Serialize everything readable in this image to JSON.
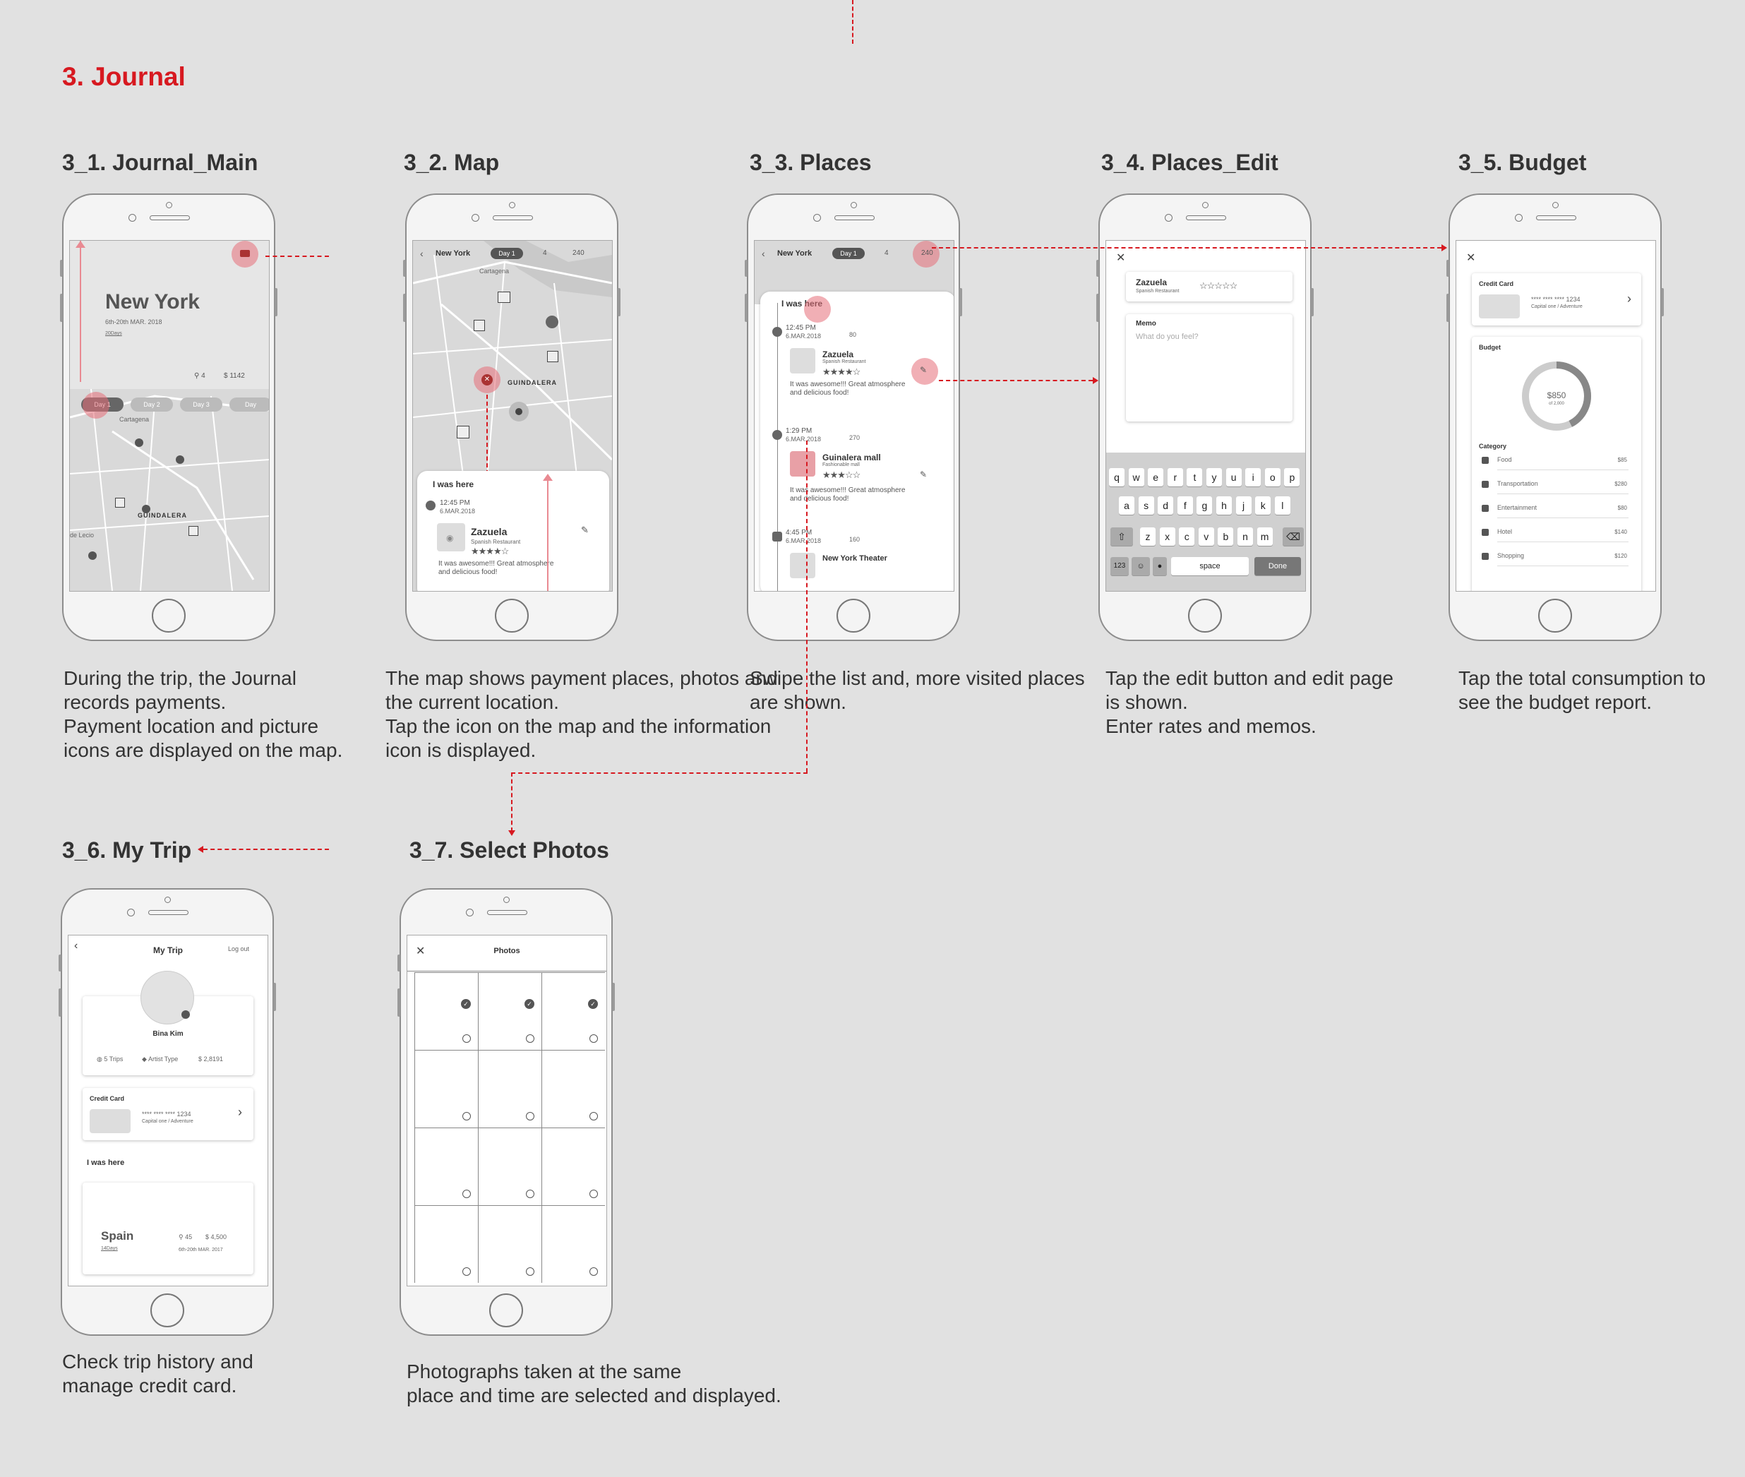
{
  "section": {
    "title": "3. Journal"
  },
  "screens": [
    {
      "title": "3_1. Journal_Main",
      "desc": "During the trip, the Journal\nrecords payments.\nPayment location and picture\nicons are displayed on the map."
    },
    {
      "title": "3_2. Map",
      "desc": "The map shows payment places, photos and\nthe current location.\nTap the icon on the map and  the information\nicon is displayed."
    },
    {
      "title": "3_3. Places",
      "desc": "Swipe the list and, more  visited places\nare shown."
    },
    {
      "title": "3_4. Places_Edit",
      "desc": "Tap the edit button and edit page\nis shown.\nEnter rates and memos."
    },
    {
      "title": "3_5. Budget",
      "desc": "Tap the total consumption to\nsee the budget report."
    },
    {
      "title": "3_6. My Trip",
      "desc": "Check trip history and\nmanage credit card."
    },
    {
      "title": "3_7. Select Photos",
      "desc": "Photographs taken at the same\nplace and time are selected and displayed."
    }
  ],
  "journal_main": {
    "city": "New York",
    "dates": "6th-20th MAR. 2018",
    "duration": "20Days",
    "pins": "4",
    "spent": "1142",
    "days": [
      "Day 1",
      "Day 2",
      "Day 3",
      "Day"
    ],
    "map_labels": [
      "Cartagena",
      "GUINDALERA",
      "de Lecio"
    ]
  },
  "map": {
    "city": "New York",
    "day": "Day 1",
    "pins": "4",
    "spent": "240",
    "area": "GUINDALERA",
    "street": "Cartagena",
    "i_was_here": "I was here",
    "time": "12:45 PM",
    "date": "6.MAR.2018",
    "place": "Zazuela",
    "type": "Spanish Restaurant",
    "stars": "★★★★☆",
    "comment": "It was awesome!!! Great atmosphere\nand delicious food!"
  },
  "places": {
    "city": "New York",
    "day": "Day 1",
    "pins": "4",
    "spent": "240",
    "i_was_here": "I was here",
    "items": [
      {
        "time": "12:45 PM",
        "date": "6.MAR.2018",
        "amount": "80",
        "name": "Zazuela",
        "type": "Spanish Restaurant",
        "stars": "★★★★☆",
        "comment": "It was awesome!!! Great atmosphere\nand delicious food!"
      },
      {
        "time": "1:29 PM",
        "date": "6.MAR.2018",
        "amount": "270",
        "name": "Guinalera mall",
        "type": "Fashionable mall",
        "stars": "★★★☆☆",
        "comment": "It was awesome!!! Great atmosphere\nand delicious food!"
      },
      {
        "time": "4:45 PM",
        "date": "6.MAR.2018",
        "amount": "160",
        "name": "New York Theater",
        "type": "",
        "stars": "",
        "comment": ""
      }
    ]
  },
  "places_edit": {
    "place": "Zazuela",
    "type": "Spanish Restaurant",
    "stars": "☆☆☆☆☆",
    "memo_label": "Memo",
    "memo_placeholder": "What do you feel?",
    "row1": [
      "q",
      "w",
      "e",
      "r",
      "t",
      "y",
      "u",
      "i",
      "o",
      "p"
    ],
    "row2": [
      "a",
      "s",
      "d",
      "f",
      "g",
      "h",
      "j",
      "k",
      "l"
    ],
    "row3": [
      "z",
      "x",
      "c",
      "v",
      "b",
      "n",
      "m"
    ],
    "key_123": "123",
    "key_space": "space",
    "key_done": "Done"
  },
  "budget": {
    "card_label": "Credit Card",
    "card_number": "**** **** **** 1234",
    "card_name": "Capital one / Adventure",
    "budget_label": "Budget",
    "total": "$850",
    "of_total": "of 2,000",
    "category_label": "Category",
    "progress": 0.425,
    "categories": [
      {
        "name": "Food",
        "amount": "$85"
      },
      {
        "name": "Transportation",
        "amount": "$280"
      },
      {
        "name": "Entertainment",
        "amount": "$80"
      },
      {
        "name": "Hotel",
        "amount": "$140"
      },
      {
        "name": "Shopping",
        "amount": "$120"
      }
    ]
  },
  "my_trip": {
    "title": "My Trip",
    "logout": "Log out",
    "user": "Bina Kim",
    "trips": "5 Trips",
    "type": "Artist Type",
    "total": "2,8191",
    "card_label": "Credit Card",
    "card_number": "**** **** **** 1234",
    "card_name": "Capital one / Adventure",
    "i_was_here": "I was here",
    "trip_country": "Spain",
    "trip_duration": "14Days",
    "trip_pins": "45",
    "trip_spent": "4,500",
    "trip_dates": "6th-20th MAR. 2017"
  },
  "photos": {
    "title": "Photos",
    "grid_rows": 4,
    "grid_cols": 3,
    "checked_row": 0
  },
  "colors": {
    "accent": "#d71920",
    "pin": "#e66e78",
    "background": "#e1e1e1"
  }
}
